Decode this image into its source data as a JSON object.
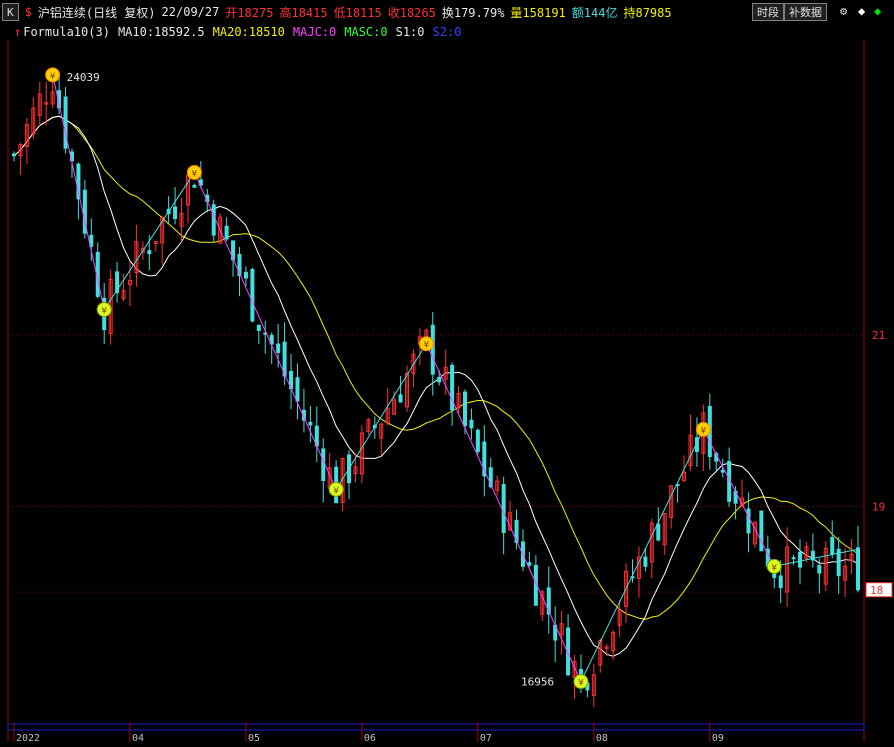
{
  "header": {
    "period_button": "K",
    "symbol": "沪铝连续(日线 复权)",
    "date": "22/09/27",
    "open_label": "开18275",
    "high_label": "高18415",
    "low_label": "低18115",
    "close_label": "收18265",
    "turnover_label": "换179.79%",
    "volume_label": "量158191",
    "amount_label": "额144亿",
    "hold_label": "持87985",
    "time_button": "时段",
    "data_button": "补数据",
    "colors": {
      "up": "#ff3030",
      "down": "#40e0e0",
      "ma10": "#ffffff",
      "ma20": "#f0f000"
    }
  },
  "legend": {
    "formula": "Formula10(3)",
    "ma10": "MA10:18592.5",
    "ma20": "MA20:18510",
    "majc": "MAJC:0",
    "masc": "MASC:0",
    "s1": "S1:0",
    "s2": "S2:0"
  },
  "chart_data": {
    "type": "candlestick",
    "ylim": [
      16600,
      24400
    ],
    "y_ticks": [
      {
        "value": 21000,
        "label": "21"
      },
      {
        "value": 19000,
        "label": "19"
      },
      {
        "value": 18000,
        "label": "18"
      }
    ],
    "x_ticks": [
      "2022",
      "04",
      "05",
      "06",
      "07",
      "08",
      "09"
    ],
    "annotations": {
      "high_label": "24039",
      "low_label": "16956",
      "last_price_label": "18"
    },
    "price_path": [
      {
        "i": 0,
        "v": 23100
      },
      {
        "i": 6,
        "v": 24039
      },
      {
        "i": 14,
        "v": 21300
      },
      {
        "i": 28,
        "v": 22900
      },
      {
        "i": 50,
        "v": 19200
      },
      {
        "i": 64,
        "v": 20900
      },
      {
        "i": 88,
        "v": 16956
      },
      {
        "i": 107,
        "v": 19900
      },
      {
        "i": 118,
        "v": 18300
      },
      {
        "i": 131,
        "v": 18265
      }
    ],
    "zigzag_points": [
      {
        "i": 6,
        "v": 24039,
        "type": "high"
      },
      {
        "i": 14,
        "v": 21300,
        "type": "low"
      },
      {
        "i": 28,
        "v": 22900,
        "type": "high"
      },
      {
        "i": 50,
        "v": 19200,
        "type": "low"
      },
      {
        "i": 64,
        "v": 20900,
        "type": "high"
      },
      {
        "i": 88,
        "v": 16956,
        "type": "low"
      },
      {
        "i": 107,
        "v": 19900,
        "type": "high"
      },
      {
        "i": 118,
        "v": 18300,
        "type": "low"
      },
      {
        "i": 131,
        "v": 18500,
        "type": "end"
      }
    ]
  }
}
